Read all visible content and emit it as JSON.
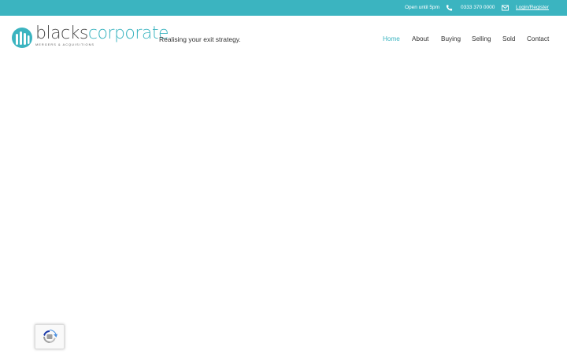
{
  "topbar": {
    "hours": "Open until 5pm",
    "phone": "0333 370 0000",
    "login": "Login/Register",
    "phone_icon": "phone-icon",
    "mail_icon": "envelope-icon"
  },
  "header": {
    "logo_part1": "blacks",
    "logo_part2": "corporate",
    "logo_sub": "MERGERS & ACQUISITIONS",
    "tagline": "Realising your exit strategy."
  },
  "nav": {
    "items": [
      {
        "label": "Home",
        "active": true
      },
      {
        "label": "About",
        "active": false
      },
      {
        "label": "Buying",
        "active": false
      },
      {
        "label": "Selling",
        "active": false
      },
      {
        "label": "Sold",
        "active": false
      },
      {
        "label": "Contact",
        "active": false
      }
    ]
  },
  "colors": {
    "accent": "#3bb4c0",
    "text": "#333333"
  },
  "widgets": {
    "recaptcha_icon": "recaptcha-icon"
  }
}
